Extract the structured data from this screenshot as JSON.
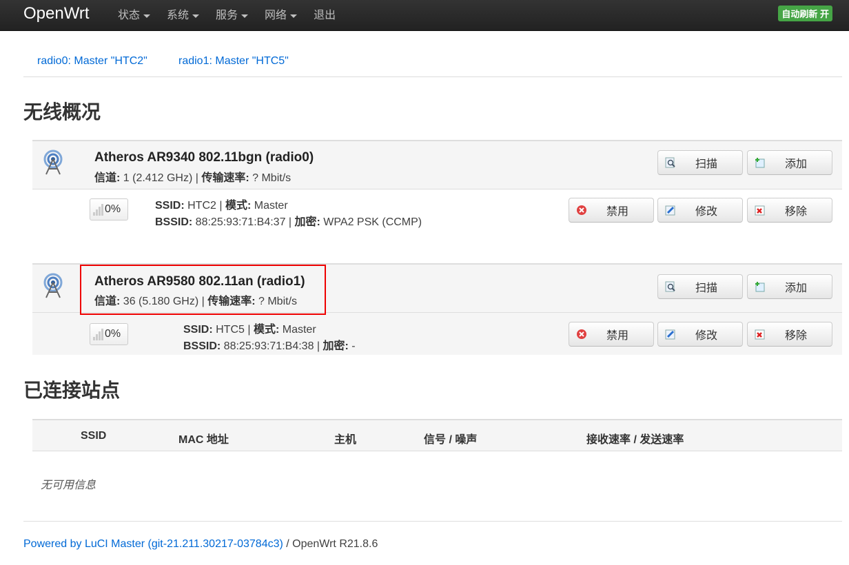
{
  "navbar": {
    "brand": "OpenWrt",
    "menu": [
      "状态",
      "系统",
      "服务",
      "网络",
      "退出"
    ],
    "refresh_badge": "自动刷新 开"
  },
  "tabs": [
    "radio0: Master \"HTC2\"",
    "radio1: Master \"HTC5\""
  ],
  "overview_title": "无线概况",
  "devices": [
    {
      "title": "Atheros AR9340 802.11bgn (radio0)",
      "channel_label": "信道:",
      "channel_value": " 1 (2.412 GHz) | ",
      "rate_label": "传输速率:",
      "rate_value": " ? Mbit/s",
      "scan_label": "扫描",
      "add_label": "添加",
      "network": {
        "signal": "0%",
        "ssid_label": "SSID:",
        "ssid_value": " HTC2 | ",
        "mode_label": "模式:",
        "mode_value": " Master",
        "bssid_label": "BSSID:",
        "bssid_value": " 88:25:93:71:B4:37 | ",
        "enc_label": "加密:",
        "enc_value": " WPA2 PSK (CCMP)",
        "disable_label": "禁用",
        "edit_label": "修改",
        "remove_label": "移除"
      }
    },
    {
      "title": "Atheros AR9580 802.11an (radio1)",
      "channel_label": "信道:",
      "channel_value": " 36 (5.180 GHz) | ",
      "rate_label": "传输速率:",
      "rate_value": " ? Mbit/s",
      "scan_label": "扫描",
      "add_label": "添加",
      "network": {
        "signal": "0%",
        "ssid_label": "SSID:",
        "ssid_value": " HTC5 | ",
        "mode_label": "模式:",
        "mode_value": " Master",
        "bssid_label": "BSSID:",
        "bssid_value": " 88:25:93:71:B4:38 | ",
        "enc_label": "加密:",
        "enc_value": " -",
        "disable_label": "禁用",
        "edit_label": "修改",
        "remove_label": "移除"
      }
    }
  ],
  "stations_title": "已连接站点",
  "stations_table": {
    "columns": [
      "SSID",
      "MAC 地址",
      "主机",
      "信号 / 噪声",
      "接收速率 / 发送速率"
    ],
    "empty_message": "无可用信息"
  },
  "footer": {
    "link_text": "Powered by LuCI Master (git-21.211.30217-03784c3)",
    "version_text": " / OpenWrt R21.8.6"
  },
  "colors": {
    "accent_link": "#0069d6",
    "badge_green": "#46a546",
    "highlight_red": "#ee0000"
  }
}
